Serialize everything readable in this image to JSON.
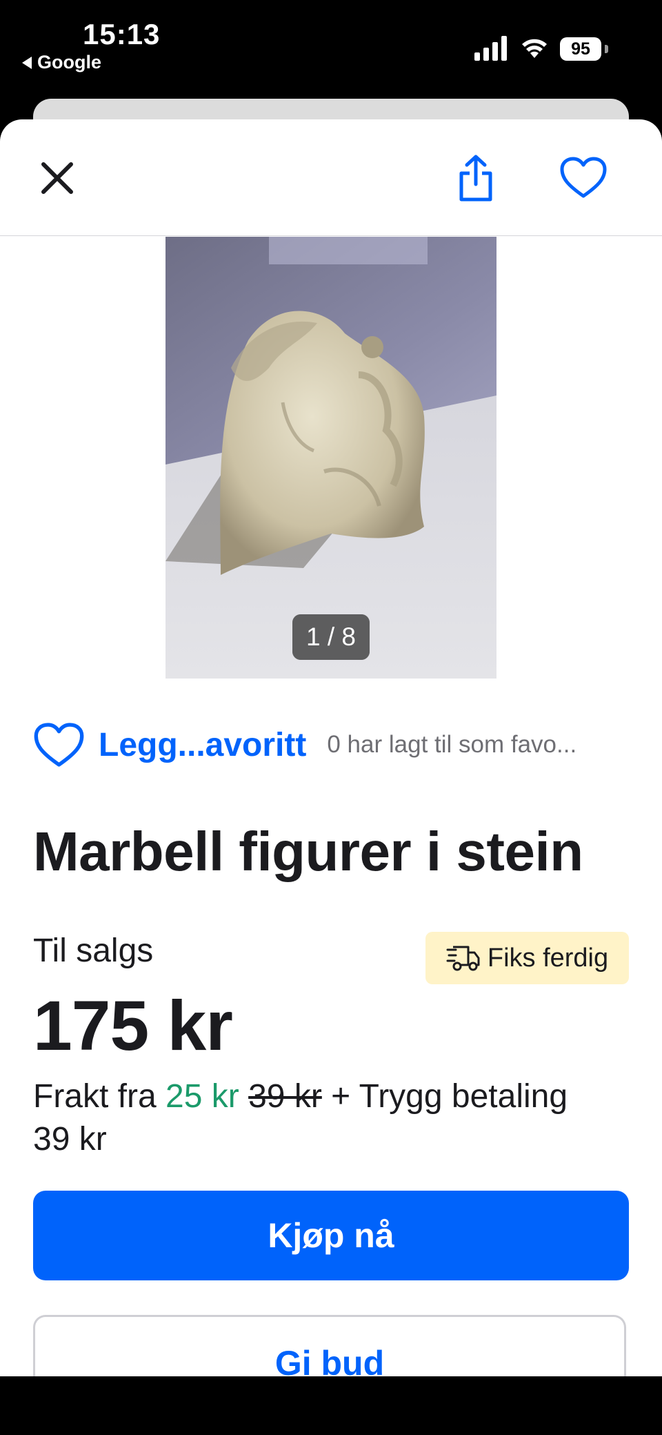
{
  "status_bar": {
    "time": "15:13",
    "back_app": "Google",
    "battery": "95"
  },
  "topbar": {
    "close_icon": "close-icon",
    "share_icon": "share-icon",
    "favorite_icon": "heart-icon"
  },
  "gallery": {
    "counter": "1 / 8"
  },
  "favorite": {
    "label": "Legg...avoritt",
    "count_text": "0 har lagt til som favo..."
  },
  "listing": {
    "title": "Marbell figurer i stein",
    "sale_label": "Til salgs",
    "badge": "Fiks ferdig",
    "price": "175 kr",
    "shipping_prefix": "Frakt fra ",
    "shipping_price": "25 kr",
    "shipping_old_price": "39 kr",
    "shipping_suffix": " + Trygg betaling 39 kr"
  },
  "actions": {
    "buy": "Kjøp nå",
    "bid": "Gi bud"
  },
  "colors": {
    "accent": "#0063fb",
    "shipping_green": "#1b9a6a",
    "badge_bg": "#fff3c8"
  }
}
